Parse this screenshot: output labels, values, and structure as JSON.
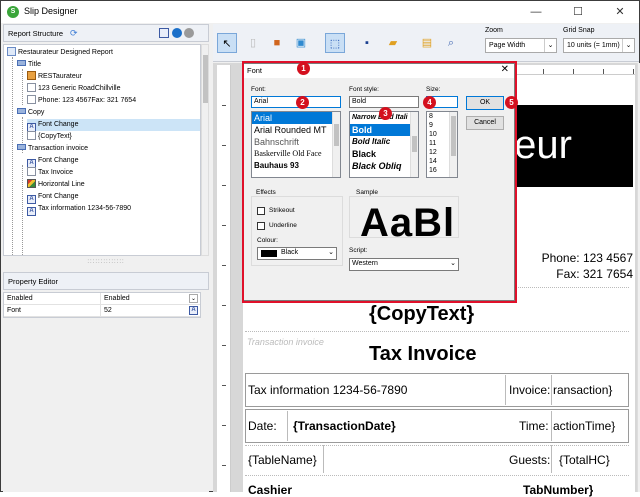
{
  "app": {
    "title": "Slip Designer"
  },
  "window_controls": {
    "minimize": "—",
    "maximize": "☐",
    "close": "✕"
  },
  "left_panel": {
    "structure_header": "Report Structure",
    "tree": [
      {
        "label": "Restaurateur Designed Report",
        "icon": "report-icon"
      },
      {
        "label": "Title",
        "icon": "band-icon"
      },
      {
        "label": "RESTaurateur",
        "icon": "picture-icon"
      },
      {
        "label": "123 Generic RoadChillville",
        "icon": "text-icon"
      },
      {
        "label": "Phone: 123 4567Fax: 321 7654",
        "icon": "text-icon"
      },
      {
        "label": "Copy",
        "icon": "band-icon"
      },
      {
        "label": "Font Change",
        "icon": "font-icon",
        "selected": true
      },
      {
        "label": "{CopyText}",
        "icon": "text-icon"
      },
      {
        "label": "Transaction invoice",
        "icon": "band-icon"
      },
      {
        "label": "Font Change",
        "icon": "font-icon"
      },
      {
        "label": "Tax Invoice",
        "icon": "text-icon"
      },
      {
        "label": "Horizontal Line",
        "icon": "line-icon"
      },
      {
        "label": "Font Change",
        "icon": "font-icon"
      },
      {
        "label": "Tax information 1234-56-7890",
        "icon": "text-icon"
      }
    ],
    "splitter_grip": "::::::::::::::",
    "property_header": "Property Editor",
    "properties": [
      {
        "name": "Enabled",
        "value": "Enabled"
      },
      {
        "name": "Font",
        "value": "52"
      }
    ]
  },
  "toolbar": {
    "zoom_label": "Zoom",
    "zoom_value": "Page Width",
    "grid_label": "Grid Snap",
    "grid_value": "10 units (= 1mm)"
  },
  "canvas": {
    "phone": "Phone: 123 4567",
    "fax": "Fax: 321 7654",
    "logo_text": "teur",
    "copy_text": "{CopyText}",
    "ghost_transaction": "Transaction invoice",
    "tax_invoice": "Tax Invoice",
    "tax_info": "Tax information 1234-56-7890",
    "invoice_label": "Invoice:",
    "invoice_value": "ransaction}",
    "date_label": "Date:",
    "date_value": "{TransactionDate}",
    "time_label": "Time:",
    "time_value": "actionTime}",
    "table_name": "{TableName}",
    "guests_label": "Guests:",
    "guests_value": "{TotalHC}",
    "cashier_label": "Cashier",
    "tab_number": "TabNumber}"
  },
  "font_dialog": {
    "title": "Font",
    "font_label": "Font:",
    "font_value": "Arial",
    "fonts": [
      "Arial",
      "Arial Rounded MT",
      "Bahnschrift",
      "Baskerville Old Face",
      "Bauhaus 93"
    ],
    "style_label": "Font style:",
    "style_value": "Bold",
    "styles": [
      "Narrow Bold Itali",
      "Bold",
      "Bold Italic",
      "Black",
      "Black Obliq"
    ],
    "size_label": "Size:",
    "size_value": "",
    "sizes": [
      "8",
      "9",
      "10",
      "11",
      "12",
      "14",
      "16"
    ],
    "ok_label": "OK",
    "cancel_label": "Cancel",
    "effects_label": "Effects",
    "strikeout_label": "Strikeout",
    "underline_label": "Underline",
    "colour_label": "Colour:",
    "colour_value": "Black",
    "sample_label": "Sample",
    "sample_text": "AaBl",
    "script_label": "Script:",
    "script_value": "Western",
    "steps": [
      "1",
      "2",
      "3",
      "4",
      "5"
    ]
  },
  "colors": {
    "highlight": "#e0102a",
    "selection": "#0078d7",
    "badge": "#d4101e"
  }
}
